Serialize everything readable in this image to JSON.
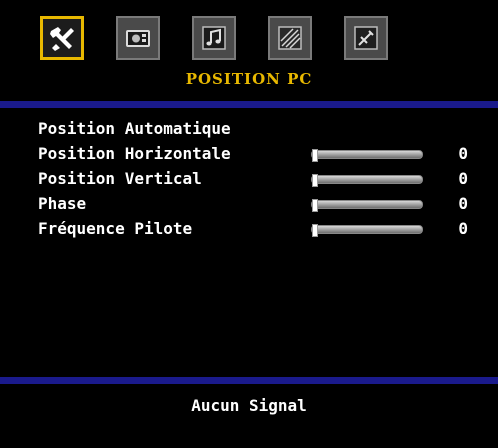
{
  "tabs": [
    {
      "icon": "wrench-screwdriver-icon",
      "active": true
    },
    {
      "icon": "tv-picture-icon",
      "active": false
    },
    {
      "icon": "music-note-icon",
      "active": false
    },
    {
      "icon": "image-settings-icon",
      "active": false
    },
    {
      "icon": "tools-icon",
      "active": false
    }
  ],
  "page_title": "POSITION PC",
  "menu": {
    "items": [
      {
        "label": "Position Automatique"
      },
      {
        "label": "Position Horizontale",
        "value": "0",
        "level": 0
      },
      {
        "label": "Position Vertical",
        "value": "0",
        "level": 0
      },
      {
        "label": "Phase",
        "value": "0",
        "level": 0
      },
      {
        "label": "Fréquence Pilote",
        "value": "0",
        "level": 0
      }
    ]
  },
  "status": {
    "text": "Aucun Signal"
  },
  "colors": {
    "accent": "#e8b800",
    "separator": "#1a1a8c",
    "background": "#000000",
    "text": "#ffffff"
  }
}
